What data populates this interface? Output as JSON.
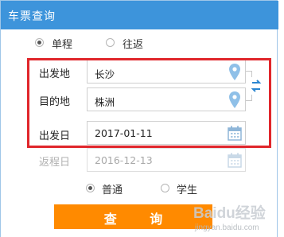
{
  "header": {
    "title": "车票查询"
  },
  "trip_type": {
    "single": "单程",
    "round": "往返",
    "selected": "single"
  },
  "from": {
    "label": "出发地",
    "value": "长沙"
  },
  "to": {
    "label": "目的地",
    "value": "株洲"
  },
  "depart": {
    "label": "出发日",
    "value": "2017-01-11"
  },
  "return": {
    "label": "返程日",
    "value": "2016-12-13"
  },
  "passenger": {
    "normal": "普通",
    "student": "学生",
    "selected": "normal"
  },
  "query_button": {
    "label": "查 询"
  },
  "watermark": {
    "logo": "Baidu经验",
    "sub": "jingyan.baidu.com"
  },
  "colors": {
    "header": "#3d94db",
    "accent": "#ff8a00",
    "highlight": "#e0262b",
    "icon": "#8fc0e8"
  }
}
